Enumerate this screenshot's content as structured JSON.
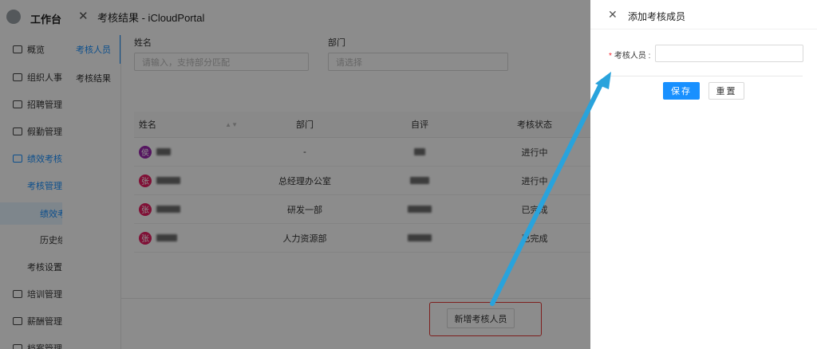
{
  "app": {
    "title": "工作台",
    "nav": [
      {
        "label": "概览",
        "level": 0
      },
      {
        "label": "组织人事",
        "level": 0
      },
      {
        "label": "招聘管理",
        "level": 0
      },
      {
        "label": "假勤管理",
        "level": 0
      },
      {
        "label": "绩效考核",
        "level": 0,
        "active": true
      },
      {
        "label": "考核管理",
        "level": 1,
        "active": true
      },
      {
        "label": "绩效考",
        "level": 2,
        "selected": true
      },
      {
        "label": "历史绩",
        "level": 2
      },
      {
        "label": "考核设置",
        "level": 1
      },
      {
        "label": "培训管理",
        "level": 0
      },
      {
        "label": "薪酬管理",
        "level": 0
      },
      {
        "label": "档案管理",
        "level": 0
      }
    ]
  },
  "drawer1": {
    "title": "考核结果 - iCloudPortal",
    "tabs": [
      "考核人员",
      "考核结果"
    ],
    "filters": {
      "name_label": "姓名",
      "name_placeholder": "请输入，支持部分匹配",
      "dept_label": "部门",
      "dept_placeholder": "请选择"
    },
    "table": {
      "columns": [
        "姓名",
        "部门",
        "自评",
        "考核状态"
      ],
      "rows": [
        {
          "avatar": "侯",
          "avatar_color": "#9c27b0",
          "dept": "-",
          "status": "进行中"
        },
        {
          "avatar": "张",
          "avatar_color": "#e91e63",
          "dept": "总经理办公室",
          "status": "进行中"
        },
        {
          "avatar": "张",
          "avatar_color": "#e91e63",
          "dept": "研发一部",
          "status": "已完成"
        },
        {
          "avatar": "张",
          "avatar_color": "#e91e63",
          "dept": "人力资源部",
          "status": "已完成"
        }
      ]
    },
    "add_member_label": "新增考核人员"
  },
  "drawer2": {
    "title": "添加考核成员",
    "field_label": "考核人员 :",
    "field_value": "",
    "save_label": "保存",
    "reset_label": "重置"
  },
  "colors": {
    "primary": "#1890ff",
    "highlight": "#e53935",
    "arrow": "#29a3dc"
  }
}
